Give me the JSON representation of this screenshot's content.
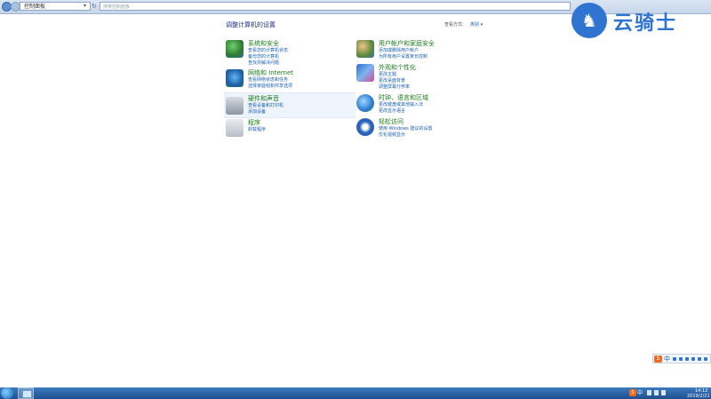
{
  "address_bar": {
    "breadcrumb": "控制面板",
    "search_placeholder": "搜索控制面板"
  },
  "main": {
    "heading": "调整计算机的设置",
    "view_by_label": "查看方式:",
    "view_by_value": "类别 ▾",
    "categories": [
      {
        "title": "系统和安全",
        "icon": "shield-icon",
        "links": [
          "查看您的计算机状态",
          "备份您的计算机",
          "查找并解决问题"
        ]
      },
      {
        "title": "网络和 Internet",
        "icon": "network-icon",
        "links": [
          "查看网络状态和任务",
          "选择家庭组和共享选项"
        ]
      },
      {
        "title": "硬件和声音",
        "icon": "printer-icon",
        "links": [
          "查看设备和打印机",
          "添加设备"
        ]
      },
      {
        "title": "程序",
        "icon": "programs-icon",
        "links": [
          "卸载程序"
        ]
      },
      {
        "title": "用户帐户和家庭安全",
        "icon": "users-icon",
        "links": [
          "添加或删除用户帐户",
          "为所有用户设置家长控制"
        ]
      },
      {
        "title": "外观和个性化",
        "icon": "appearance-icon",
        "links": [
          "更改主题",
          "更改桌面背景",
          "调整屏幕分辨率"
        ]
      },
      {
        "title": "时钟、语言和区域",
        "icon": "globe-icon",
        "links": [
          "更改键盘或其他输入法",
          "更改显示语言"
        ]
      },
      {
        "title": "轻松访问",
        "icon": "accessibility-icon",
        "links": [
          "使用 Windows 建议的设置",
          "优化视频显示"
        ]
      }
    ]
  },
  "watermark": {
    "text": "云骑士",
    "logo": "knight-logo-icon"
  },
  "ime_bar": {
    "mode": "中"
  },
  "taskbar": {
    "tray_ime": "中",
    "time": "14:12",
    "date": "2019/2/21"
  },
  "colors": {
    "category_title": "#1c7d1c",
    "link": "#1a5fb4",
    "heading": "#1e3287",
    "taskbar": "#2a62a8"
  }
}
